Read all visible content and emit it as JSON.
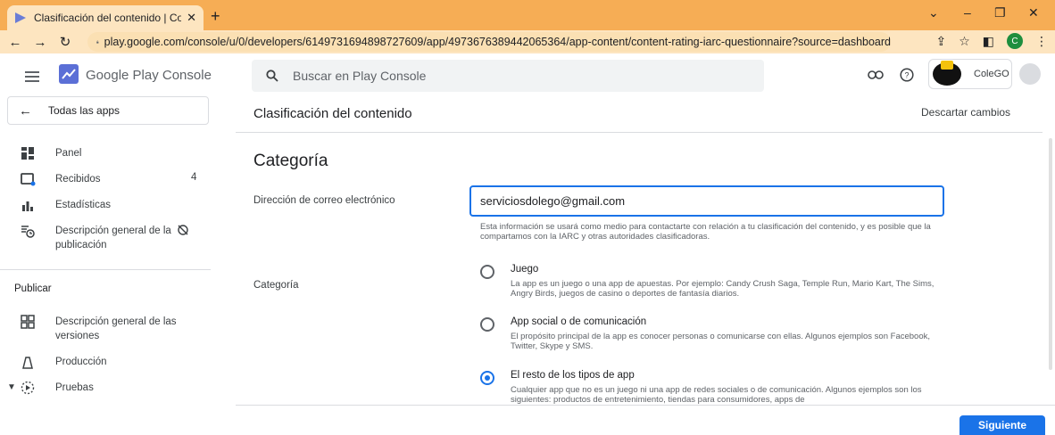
{
  "browser": {
    "tab_title": "Clasificación del contenido | Cole",
    "url": "play.google.com/console/u/0/developers/6149731694898727609/app/4973676389442065364/app-content/content-rating-iarc-questionnaire?source=dashboard",
    "profile_initial": "C"
  },
  "header": {
    "brand": "Google Play Console",
    "search_placeholder": "Buscar en Play Console",
    "account_name": "ColeGO"
  },
  "sidebar": {
    "all_apps": "Todas las apps",
    "items": [
      {
        "label": "Panel",
        "icon": "dashboard-icon"
      },
      {
        "label": "Recibidos",
        "icon": "inbox-icon",
        "badge": "4"
      },
      {
        "label": "Estadísticas",
        "icon": "bar-chart-icon"
      },
      {
        "label": "Descripción general de la publicación",
        "icon": "publishing-icon"
      }
    ],
    "section_publish": "Publicar",
    "publish_items": [
      {
        "label": "Descripción general de las versiones",
        "icon": "releases-icon"
      },
      {
        "label": "Producción",
        "icon": "production-icon"
      },
      {
        "label": "Pruebas",
        "icon": "testing-icon"
      }
    ]
  },
  "main": {
    "title": "Clasificación del contenido",
    "discard": "Descartar cambios",
    "section_title": "Categoría",
    "email_label": "Dirección de correo electrónico",
    "email_value": "serviciosdolego@gmail.com",
    "email_help": "Esta información se usará como medio para contactarte con relación a tu clasificación del contenido, y es posible que la compartamos con la IARC y otras autoridades clasificadoras.",
    "category_label": "Categoría",
    "options": [
      {
        "title": "Juego",
        "desc": "La app es un juego o una app de apuestas. Por ejemplo: Candy Crush Saga, Temple Run, Mario Kart, The Sims, Angry Birds, juegos de casino o deportes de fantasía diarios."
      },
      {
        "title": "App social o de comunicación",
        "desc": "El propósito principal de la app es conocer personas o comunicarse con ellas. Algunos ejemplos son Facebook, Twitter, Skype y SMS."
      },
      {
        "title": "El resto de los tipos de app",
        "desc": "Cualquier app que no es un juego ni una app de redes sociales o de comunicación. Algunos ejemplos son los siguientes: productos de entretenimiento, tiendas para consumidores, apps de"
      }
    ],
    "selected_option": 2,
    "next": "Siguiente"
  },
  "colors": {
    "chrome_orange": "#f6ad55",
    "accent_blue": "#1a73e8"
  }
}
